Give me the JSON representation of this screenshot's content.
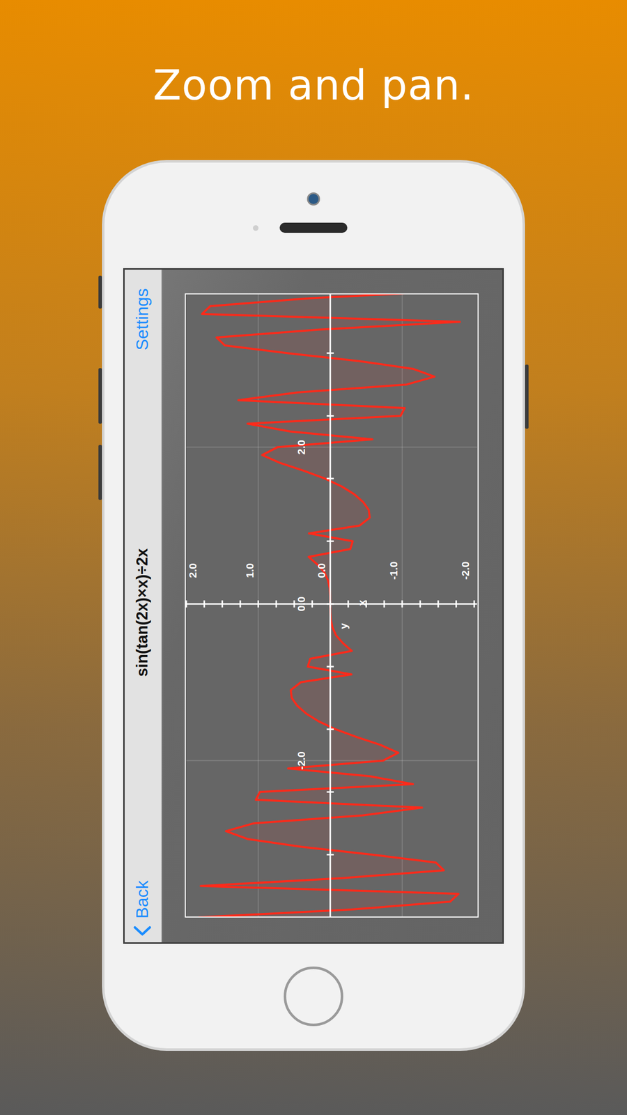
{
  "headline": "Zoom and pan.",
  "nav_bar": {
    "back": "Back",
    "title": "sin(tan(2x)×x)÷2x",
    "settings": "Settings"
  },
  "chart": {
    "x_ticks": [
      {
        "label": "-2.0",
        "value": -2
      },
      {
        "label": "0.0",
        "value": 0
      },
      {
        "label": "2.0",
        "value": 2
      }
    ],
    "y_ticks": [
      {
        "label": "2.0",
        "value": 2
      },
      {
        "label": "1.0",
        "value": 1
      },
      {
        "label": "0.0",
        "value": 0
      },
      {
        "label": "-1.0",
        "value": -1
      },
      {
        "label": "-2.0",
        "value": -2
      }
    ],
    "x_axis_label": "x",
    "y_axis_label": "y",
    "series": [
      {
        "color": "#ff2a1a",
        "x": [
          -4.0,
          -3.9,
          -3.8,
          -3.7,
          -3.6,
          -3.5,
          -3.4,
          -3.3,
          -3.2,
          -3.1,
          -3.0,
          -2.9,
          -2.8,
          -2.7,
          -2.6,
          -2.5,
          -2.4,
          -2.3,
          -2.2,
          -2.1,
          -2.0,
          -1.9,
          -1.8,
          -1.7,
          -1.6,
          -1.5,
          -1.4,
          -1.3,
          -1.2,
          -1.1,
          -1.0,
          -0.9,
          -0.8,
          -0.7,
          -0.6,
          -0.5,
          -0.4,
          -0.3,
          -0.2,
          -0.1,
          0.0,
          0.1,
          0.2,
          0.3,
          0.4,
          0.5,
          0.6,
          0.7,
          0.8,
          0.9,
          1.0,
          1.1,
          1.2,
          1.3,
          1.4,
          1.5,
          1.6,
          1.7,
          1.8,
          1.9,
          2.0,
          2.1,
          2.2,
          2.3,
          2.4,
          2.5,
          2.6,
          2.7,
          2.8,
          2.9,
          3.0,
          3.1,
          3.2,
          3.3,
          3.4,
          3.5,
          3.6,
          3.7,
          3.8,
          3.9,
          4.0
        ],
        "y": [
          1.83,
          -0.3,
          -1.667,
          -1.782,
          1.8,
          -0.16,
          -1.579,
          -1.466,
          -0.587,
          0.396,
          1.15,
          1.449,
          1.063,
          -0.447,
          -1.277,
          1.034,
          0.977,
          -1.149,
          -0.555,
          0.586,
          -0.735,
          -0.945,
          -0.698,
          -0.369,
          -0.075,
          0.159,
          0.334,
          0.458,
          0.535,
          0.549,
          0.409,
          -0.295,
          0.312,
          0.278,
          -0.3,
          -0.176,
          -0.08,
          -0.031,
          -0.008,
          -0.001,
          0.0,
          0.001,
          0.008,
          0.031,
          0.08,
          0.176,
          0.3,
          -0.278,
          -0.312,
          0.295,
          -0.409,
          -0.549,
          -0.535,
          -0.458,
          -0.334,
          -0.159,
          0.075,
          0.369,
          0.698,
          0.945,
          0.735,
          -0.586,
          0.555,
          1.149,
          -0.977,
          -1.034,
          1.277,
          0.447,
          -1.063,
          -1.449,
          -1.15,
          -0.396,
          0.587,
          1.466,
          1.579,
          0.16,
          -1.8,
          1.782,
          1.667,
          0.3,
          -1.83
        ]
      }
    ]
  }
}
